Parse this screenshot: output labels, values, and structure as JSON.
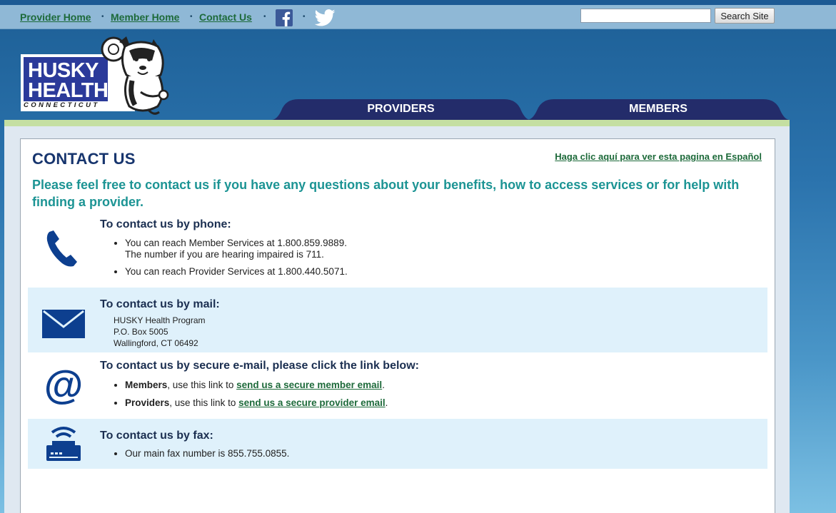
{
  "topnav": {
    "links": [
      "Provider Home",
      "Member Home",
      "Contact Us"
    ],
    "separator": "•",
    "facebook_icon": "facebook-icon",
    "twitter_icon": "twitter-icon",
    "search_placeholder": "",
    "search_button": "Search Site"
  },
  "logo": {
    "line1": "HUSKY",
    "line2": "HEALTH",
    "line3": "CONNECTICUT"
  },
  "tabs": [
    "PROVIDERS",
    "MEMBERS"
  ],
  "page": {
    "title": "CONTACT US",
    "spanish_link": "Haga clic aquí para ver esta pagina en Español",
    "intro": "Please feel free to contact us if you have any questions about your benefits, how to access services or for help with finding a provider."
  },
  "phone": {
    "heading": "To contact us by phone:",
    "item1_line1": "You can reach Member Services at 1.800.859.9889.",
    "item1_line2": "The number if you are hearing impaired is 711.",
    "item2": "You can reach Provider Services at 1.800.440.5071."
  },
  "mail": {
    "heading": "To contact us by mail:",
    "address": [
      "HUSKY Health Program",
      "P.O. Box 5005",
      "Wallingford, CT 06492"
    ]
  },
  "email": {
    "heading": "To contact us by secure e-mail, please click the link below:",
    "members_label": "Members",
    "members_text": ", use this link to ",
    "members_link": "send us a secure member email",
    "providers_label": "Providers",
    "providers_text": ", use this link to ",
    "providers_link": "send us a secure provider email",
    "period": "."
  },
  "fax": {
    "heading": "To contact us by fax:",
    "item": "Our main fax number is 855.755.0855."
  },
  "colors": {
    "navy": "#17356e",
    "teal": "#1c9494",
    "link_green": "#1d6a3a",
    "tab_navy": "#232c6a",
    "icon_blue": "#0d3f8f"
  }
}
